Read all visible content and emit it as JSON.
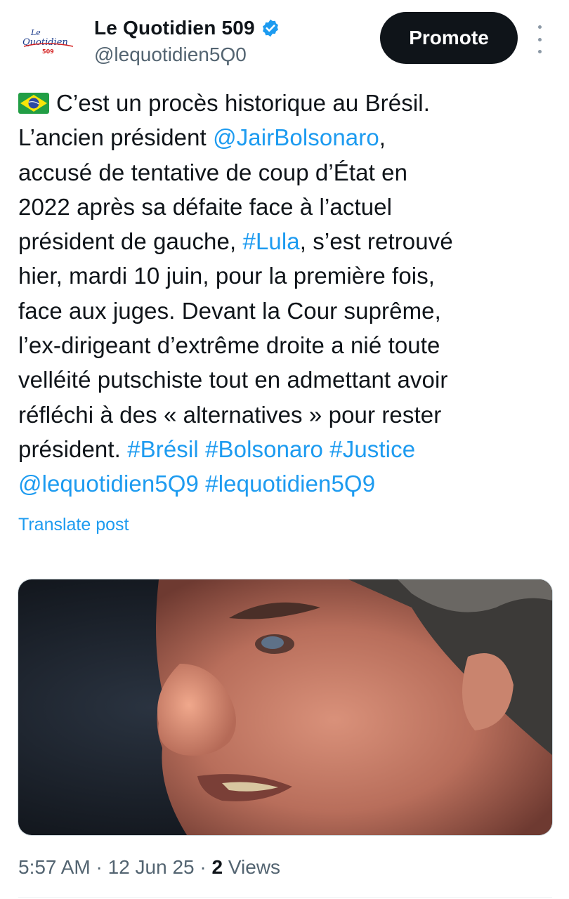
{
  "account": {
    "avatar_line1": "Le",
    "avatar_line2": "Quotidien",
    "avatar_line3": "509",
    "name": "Le Quotidien 509",
    "handle": "@lequotidien5Ϙ0"
  },
  "actions": {
    "promote_label": "Promote",
    "more_icon": "more-vertical-icon"
  },
  "post": {
    "flag_icon": "brazil-flag-icon",
    "l1": "C’est un procès historique au Brésil.",
    "l2a": "L’ancien président ",
    "mention1": "@JairBolsonaro",
    "l2b": ",",
    "l3": "accusé de tentative de coup d’État en",
    "l4": "2022 après sa défaite face à l’actuel",
    "l5a": "président de gauche, ",
    "tag_lula": "#Lula",
    "l5b": ", s’est retrouvé",
    "l6": "hier, mardi 10 juin, pour la première fois,",
    "l7": "face aux juges. Devant la Cour suprême,",
    "l8": "l’ex-dirigeant d’extrême droite a nié toute",
    "l9": "velléité putschiste tout en admettant avoir",
    "l10": "réfléchi à des « alternatives » pour rester",
    "l11a": "président.  ",
    "tag_bresil": "#Brésil",
    "tag_bolsonaro": "#Bolsonaro",
    "tag_justice": "#Justice",
    "mention2": "@lequotidien5Ϙ9",
    "tag_lq": "#lequotidien5Ϙ9",
    "translate_label": "Translate post"
  },
  "meta": {
    "time": "5:57 AM",
    "sep": "·",
    "date": "12 Jun 25",
    "views_count": "2",
    "views_label": "Views"
  },
  "colors": {
    "link": "#1d9bf0",
    "secondary_text": "#536471",
    "button_bg": "#0f1419"
  }
}
